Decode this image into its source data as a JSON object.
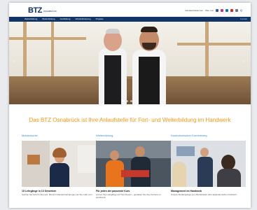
{
  "header": {
    "logo_mark": "BTZ",
    "logo_sub": "OSNABRÜCK",
    "utility_text": "Handwerkskammer · Über uns",
    "search_label": "Q"
  },
  "nav": {
    "items": [
      "Weiterbildung",
      "Weiterbildung",
      "Ausbildung",
      "Arbeitsförderung",
      "Projekte"
    ],
    "right": "Kontakt"
  },
  "headline": "Das BTZ Osnabrück ist Ihre Anlaufstelle für Fort- und Weiterbildung im Handwerk",
  "columns": [
    {
      "heading": "Meisterkurse",
      "title": "15 Lehrgänge in 13 Gewerken",
      "text": "Suchen Sie sich Ihr Ziel aus. Mit dem Meisterbrief bringen wir Sie nach vorn."
    },
    {
      "heading": "Weiterbildung",
      "title": "Für jeden der passende Kurs",
      "text": "Lernen Sie Lehrgänge auf Top-Niveau – gestalten Sie Ihre Karriere im Handwerk."
    },
    {
      "heading": "Kaufmännischer Karriereweg",
      "title": "Management im Handwerk",
      "text": "Unsere Studiengänge zum Betriebswirt oder kaufmännischen Fachwirt."
    }
  ],
  "colors": {
    "brand_navy": "#103566",
    "headline_orange": "#f39a1f",
    "heading_blue": "#3c8fcf"
  }
}
